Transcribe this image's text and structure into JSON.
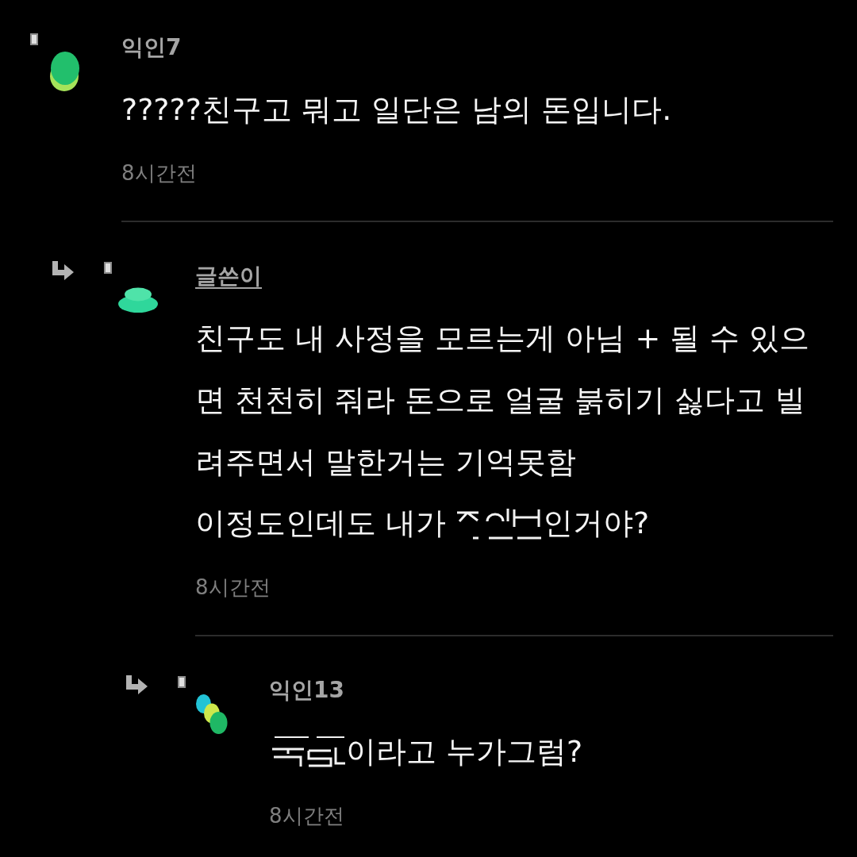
{
  "comments": [
    {
      "author": "익인7",
      "op": false,
      "avatar": {
        "kind": "single"
      },
      "body": [
        {
          "kind": "paragraph",
          "lines": [
            "?????친구고 뭐고 일단은 남의 돈입니다."
          ]
        }
      ],
      "time": "8시간전",
      "replies": [
        {
          "author": "글쓴이",
          "op": true,
          "avatar": {
            "kind": "stacked"
          },
          "body": [
            {
              "kind": "paragraph",
              "lines": [
                "친구도 내 사정을 모르는게 아님 + 될 수 있으",
                "면 천천히 줘라 돈으로 얼굴 붉히기 싫다고 빌",
                "려주면서 말한거는 기억못함"
              ]
            },
            {
              "kind": "line",
              "parts": [
                {
                  "kind": "text",
                  "text": "이정도인데도 내가"
                },
                {
                  "kind": "topfragments"
                },
                {
                  "kind": "text",
                  "text": "인거야?"
                }
              ]
            }
          ],
          "time": "8시간전",
          "replies": [
            {
              "author": "익인13",
              "op": false,
              "avatar": {
                "kind": "cluster"
              },
              "body": [
                {
                  "kind": "line",
                  "parts": [
                    {
                      "kind": "bottomfragments"
                    },
                    {
                      "kind": "text",
                      "text": "이라고 누가그럼?"
                    }
                  ]
                }
              ],
              "time": "8시간전"
            }
          ]
        }
      ]
    }
  ]
}
